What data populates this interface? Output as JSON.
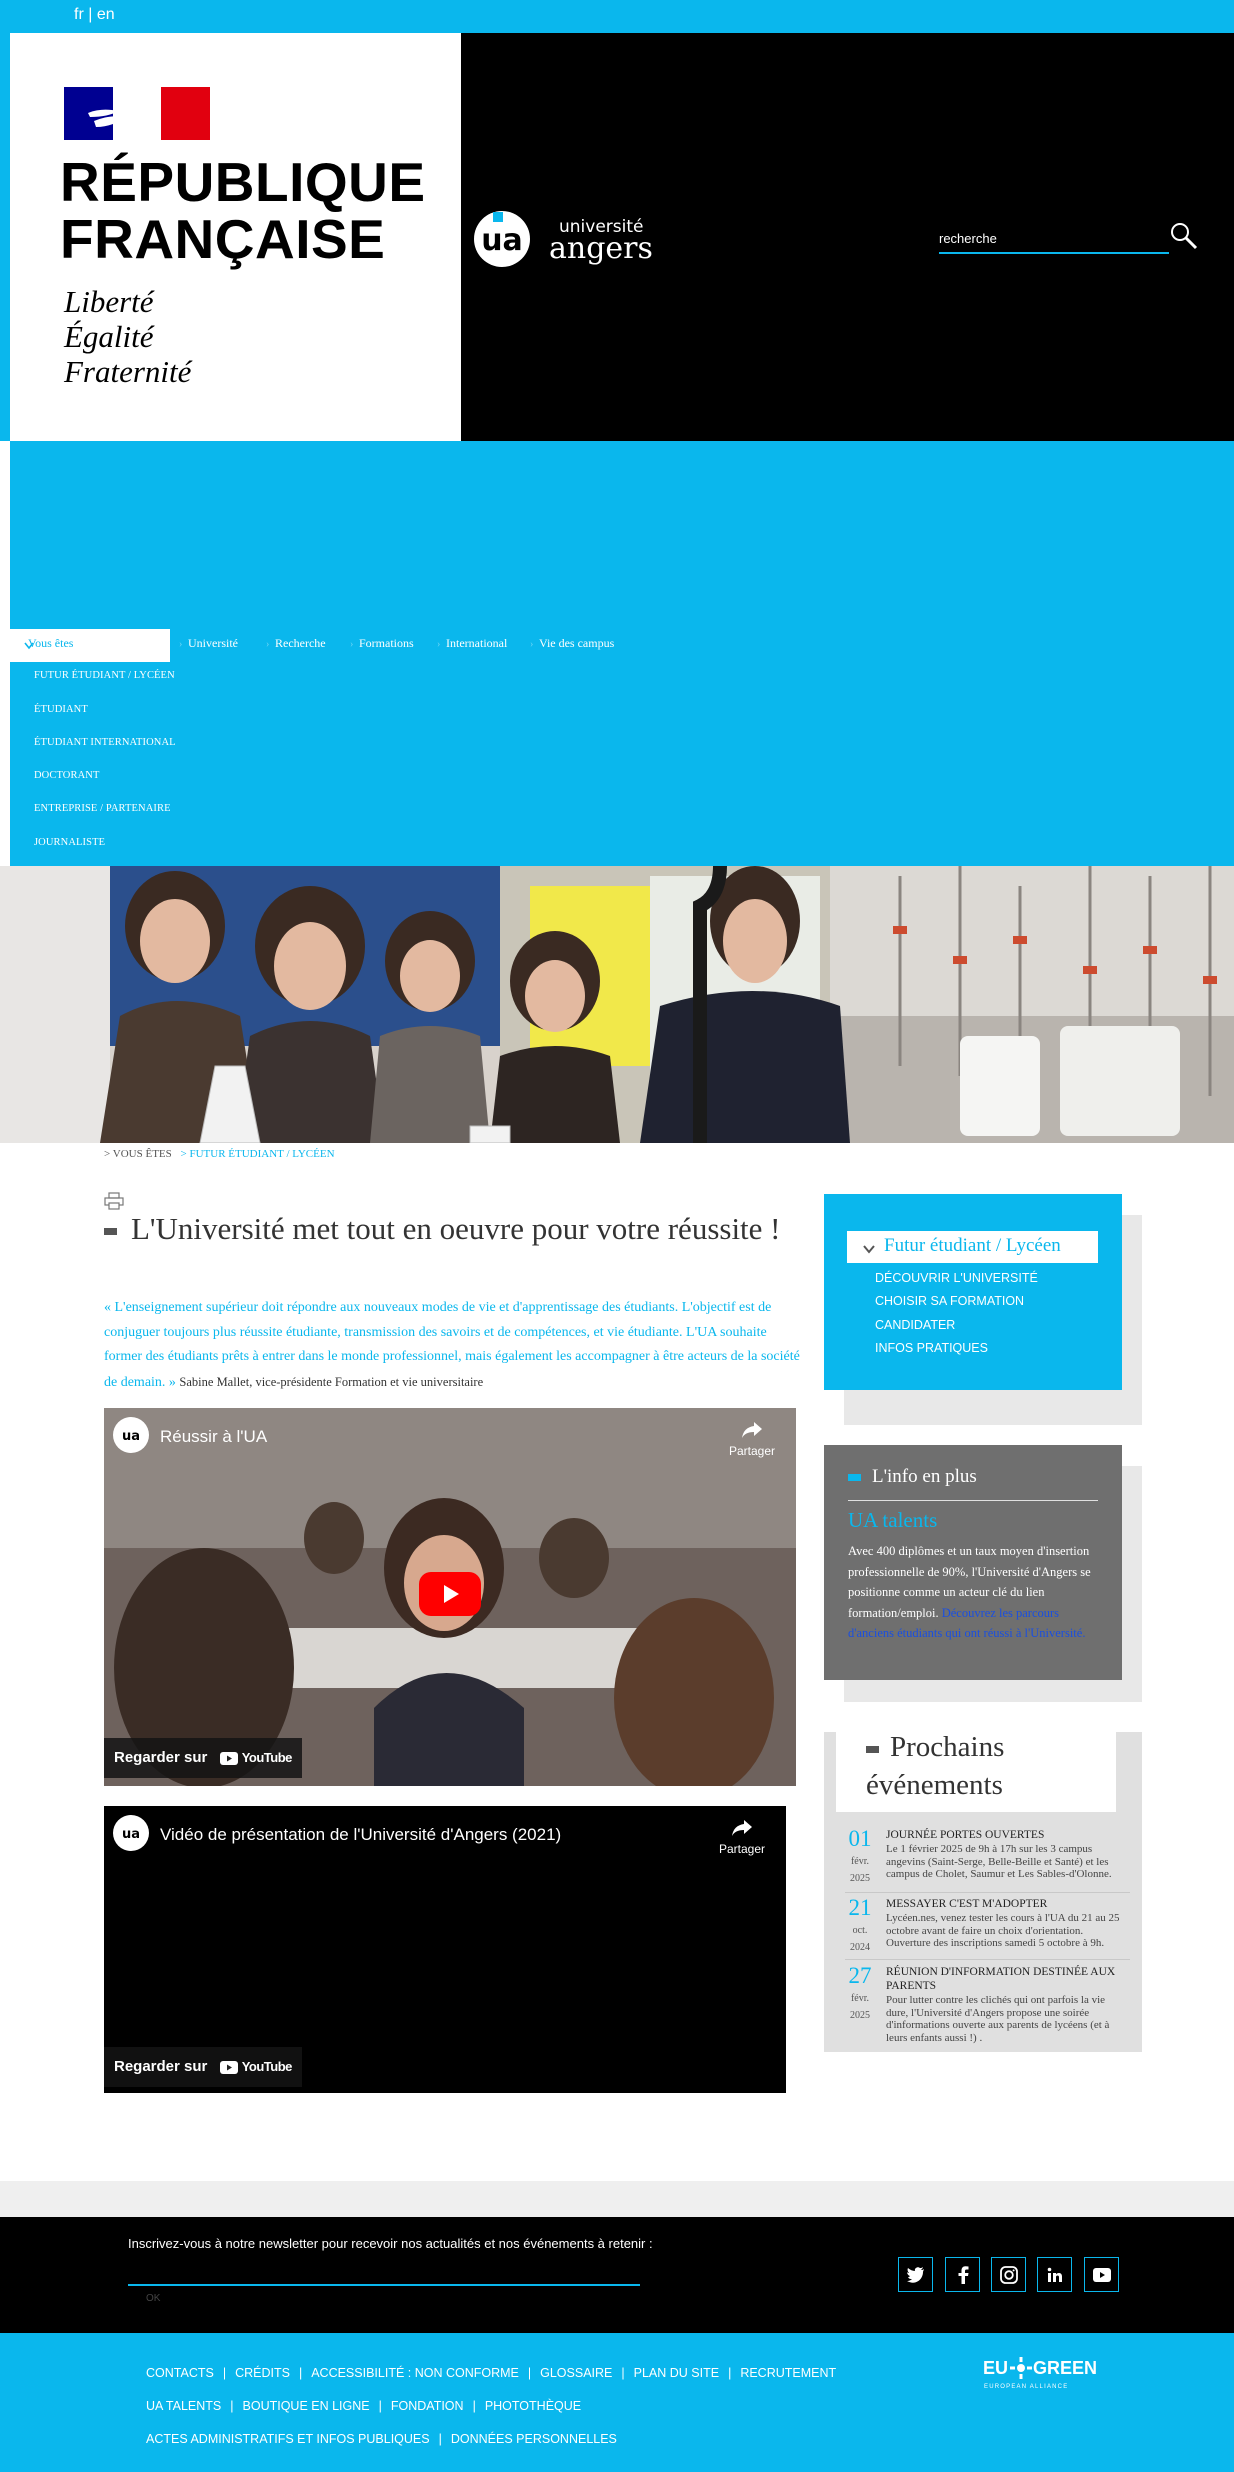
{
  "topbar": {
    "lang_fr": "fr",
    "lang_sep": "|",
    "lang_en": "en"
  },
  "republique": {
    "title_line1": "RÉPUBLIQUE",
    "title_line2": "FRANÇAISE",
    "motto1": "Liberté",
    "motto2": "Égalité",
    "motto3": "Fraternité"
  },
  "ua_logo": {
    "word1": "université",
    "word2": "angers"
  },
  "search": {
    "value": "recherche",
    "icon": "search-icon"
  },
  "nav": {
    "active": "Vous êtes",
    "items": [
      "Université",
      "Recherche",
      "Formations",
      "International",
      "Vie des campus"
    ],
    "sub_items": [
      "Futur étudiant / Lycéen",
      "Étudiant",
      "Étudiant international",
      "Doctorant",
      "Entreprise / Partenaire",
      "Journaliste"
    ]
  },
  "breadcrumb": {
    "item1": "Vous êtes",
    "item2": "Futur étudiant / Lycéen"
  },
  "main": {
    "title": "L'Université met tout en oeuvre pour votre réussite !",
    "quote_text": "« L'enseignement supérieur doit répondre aux nouveaux modes de vie et d'apprentissage des étudiants. L'objectif est de conjuguer toujours plus réussite étudiante, transmission des savoirs et de compétences, et vie étudiante. L'UA souhaite former des étudiants prêts à entrer dans le monde professionnel, mais également les accompagner à être acteurs de la société de demain. »",
    "quote_attrib": "Sabine Mallet, vice-présidente Formation et vie universitaire"
  },
  "videos": [
    {
      "title": "Réussir à l'UA",
      "share": "Partager",
      "watch": "Regarder sur",
      "yt": "YouTube"
    },
    {
      "title": "Vidéo de présentation de l'Université d'Angers (2021)",
      "share": "Partager",
      "watch": "Regarder sur",
      "yt": "YouTube"
    }
  ],
  "sidebar": {
    "box1": {
      "heading": "Futur étudiant / Lycéen",
      "links": [
        "Découvrir l'université",
        "Choisir sa formation",
        "Candidater",
        "Infos pratiques"
      ]
    },
    "box2": {
      "title": "L'info en plus",
      "subtitle": "UA talents",
      "text": "Avec 400 diplômes et un taux moyen d'insertion professionnelle de 90%, l'Université d'Angers se positionne comme un acteur clé du lien formation/emploi.",
      "more": "Découvrez les parcours d'anciens étudiants qui ont réussi à l'Université."
    },
    "box3": {
      "title": "Prochains événements",
      "events": [
        {
          "day": "01",
          "month": "févr.",
          "year": "2025",
          "title": "Journée portes ouvertes",
          "desc": "Le 1 février 2025 de 9h à 17h sur les 3 campus angevins (Saint-Serge, Belle-Beille et Santé) et les campus de Cholet, Saumur et Les Sables-d'Olonne."
        },
        {
          "day": "21",
          "month": "oct.",
          "year": "2024",
          "title": "Messayer c'est m'adopter",
          "desc": "Lycéen.nes, venez tester les cours à l'UA du 21 au 25 octobre avant de faire un choix d'orientation. Ouverture des inscriptions samedi 5 octobre à 9h."
        },
        {
          "day": "27",
          "month": "févr.",
          "year": "2025",
          "title": "Réunion d'information destinée aux parents",
          "desc": "Pour lutter contre les clichés qui ont parfois la vie dure, l'Université d'Angers propose une soirée d'informations ouverte aux parents de lycéens (et à leurs enfants aussi !) ."
        }
      ]
    }
  },
  "footer": {
    "newsletter_label": "Inscrivez-vous à notre newsletter pour recevoir nos actualités et nos événements à retenir :",
    "newsletter_value": "",
    "ok": "OK",
    "social": [
      "twitter-icon",
      "facebook-icon",
      "instagram-icon",
      "linkedin-icon",
      "youtube-icon"
    ],
    "links_row1": [
      "Contacts",
      "Crédits",
      "Accessibilité : non conforme",
      "Glossaire",
      "Plan du site",
      "Recrutement"
    ],
    "links_row2": [
      "UA talents",
      "Boutique en ligne",
      "Fondation",
      "Photothèque"
    ],
    "links_row3": [
      "Actes administratifs et infos publiques",
      "Données personnelles"
    ],
    "eugreen": {
      "word1": "EU",
      "word2": "GREEN",
      "tag": "EUROPEAN ALLIANCE"
    },
    "sep": "|"
  },
  "colors": {
    "accent": "#0ab7ed",
    "black": "#000000",
    "gray_box": "#6f6f6f",
    "light_gray": "#e0e0e0"
  }
}
